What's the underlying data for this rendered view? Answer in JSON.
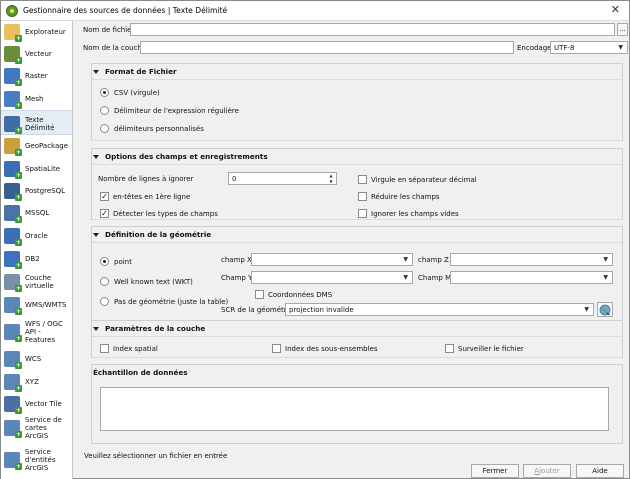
{
  "window": {
    "title": "Gestionnaire des sources de données | Texte Délimité",
    "close": "✕"
  },
  "sidebar": {
    "items": [
      {
        "label": "Explorateur",
        "color": "#e8c15a"
      },
      {
        "label": "Vecteur",
        "color": "#6b8e3a"
      },
      {
        "label": "Raster",
        "color": "#3f7ac0"
      },
      {
        "label": "Mesh",
        "color": "#4a7ec4"
      },
      {
        "label": "Texte\nDélimité",
        "color": "#3d6ea8"
      },
      {
        "label": "GeoPackage",
        "color": "#c9a13a"
      },
      {
        "label": "SpatiaLite",
        "color": "#3b6fb4"
      },
      {
        "label": "PostgreSQL",
        "color": "#35608f"
      },
      {
        "label": "MSSQL",
        "color": "#4a74a8"
      },
      {
        "label": "Oracle",
        "color": "#3b6fb4"
      },
      {
        "label": "DB2",
        "color": "#3d72c0"
      },
      {
        "label": "Couche\nvirtuelle",
        "color": "#7a8fa8"
      },
      {
        "label": "WMS/WMTS",
        "color": "#5b86b8"
      },
      {
        "label": "WFS / OGC\nAPI -\nFeatures",
        "color": "#5b86b8"
      },
      {
        "label": "WCS",
        "color": "#5b86b8"
      },
      {
        "label": "XYZ",
        "color": "#5b86b8"
      },
      {
        "label": "Vector Tile",
        "color": "#4a6fa0"
      },
      {
        "label": "Service de\ncartes ArcGIS",
        "color": "#5b86b8"
      },
      {
        "label": "Service\nd'entités\nArcGIS",
        "color": "#5b86b8"
      }
    ]
  },
  "file": {
    "label": "Nom de fichier",
    "value": "",
    "browse": "..."
  },
  "layer": {
    "label": "Nom de la couche",
    "value": "",
    "encoding_label": "Encodage",
    "encoding": "UTF-8"
  },
  "format": {
    "title": "Format de Fichier",
    "options": [
      "CSV (virgule)",
      "Délimiteur de l'expression régulière",
      "délimiteurs personnalisés"
    ]
  },
  "fields": {
    "title": "Options des champs et enregistrements",
    "skip_label": "Nombre de lignes à ignorer",
    "skip_value": "0",
    "headers": "en-têtes en 1ère ligne",
    "detect": "Détecter les types de champs",
    "decimal_comma": "Virgule en séparateur décimal",
    "trim": "Réduire les champs",
    "discard_empty": "Ignorer les champs vides"
  },
  "geometry": {
    "title": "Définition de la géométrie",
    "opt_point": "point",
    "opt_wkt": "Well known text (WKT)",
    "opt_none": "Pas de géométrie (juste la table)",
    "x_label": "champ X",
    "y_label": "Champ Y",
    "z_label": "champ Z",
    "m_label": "Champ M",
    "dms": "Coordonnées DMS",
    "crs_label": "SCR de la géométrie",
    "crs_value": "projection invalide"
  },
  "layer_settings": {
    "title": "Paramètres de la couche",
    "spatial_index": "Index spatial",
    "subset_index": "Index des sous-ensembles",
    "watch": "Surveiller le fichier"
  },
  "sample": {
    "title": "Échantillon de données"
  },
  "status": "Veuillez sélectionner un fichier en entrée",
  "buttons": {
    "close": "Fermer",
    "add": "Ajouter",
    "help": "Aide"
  }
}
